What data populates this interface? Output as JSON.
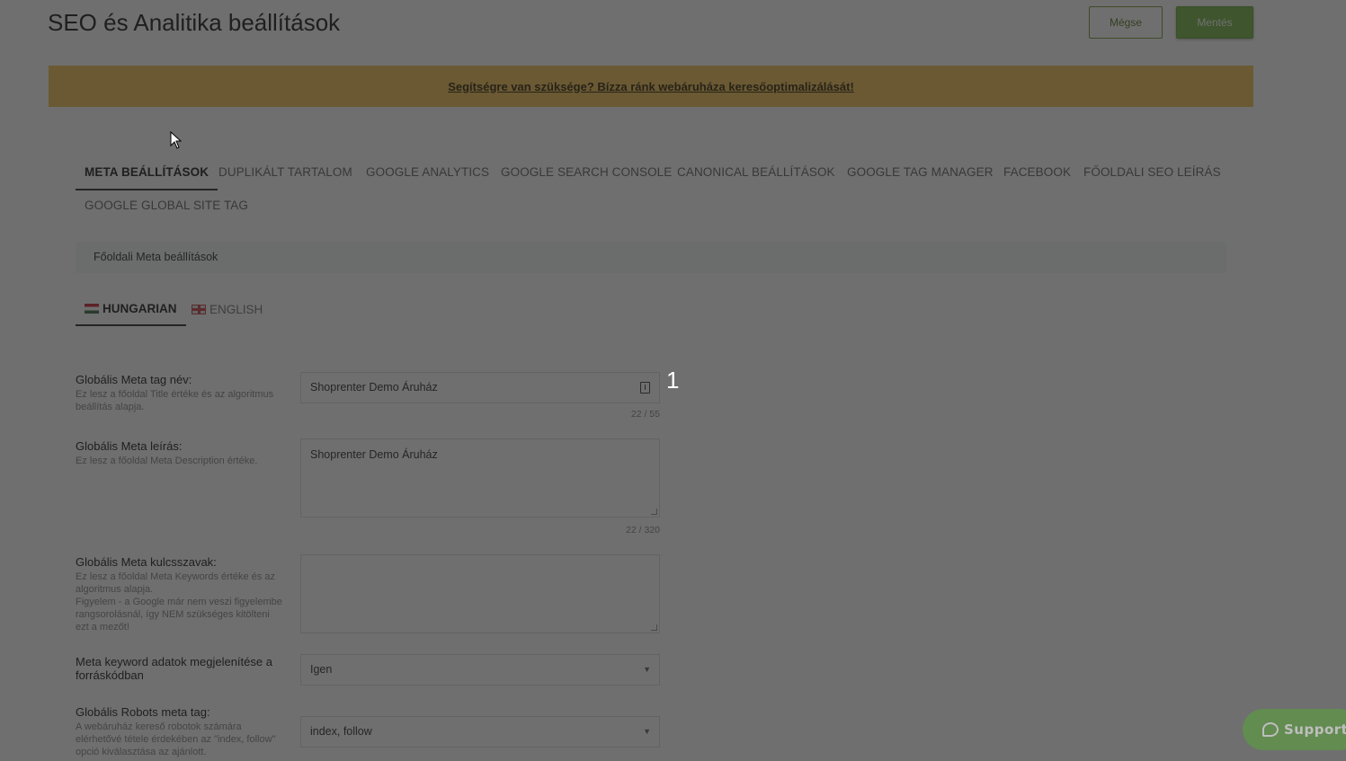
{
  "header": {
    "title": "SEO és Analitika beállítások",
    "cancel_label": "Mégse",
    "save_label": "Mentés"
  },
  "banner": {
    "link_text": "Segítségre van szüksége? Bízza ránk webáruháza keresőoptimalizálását!"
  },
  "tabs": [
    {
      "label": "META BEÁLLÍTÁSOK",
      "active": true
    },
    {
      "label": "DUPLIKÁLT TARTALOM",
      "active": false
    },
    {
      "label": "GOOGLE ANALYTICS",
      "active": false
    },
    {
      "label": "GOOGLE SEARCH CONSOLE",
      "active": false
    },
    {
      "label": "CANONICAL BEÁLLÍTÁSOK",
      "active": false
    },
    {
      "label": "GOOGLE TAG MANAGER",
      "active": false
    },
    {
      "label": "FACEBOOK",
      "active": false
    },
    {
      "label": "FŐOLDALI SEO LEÍRÁS",
      "active": false
    },
    {
      "label": "GOOGLE GLOBAL SITE TAG",
      "active": false
    }
  ],
  "section": {
    "title": "Főoldali Meta beállítások"
  },
  "languages": [
    {
      "label": "HUNGARIAN",
      "flag": "flag-hu",
      "active": true
    },
    {
      "label": "ENGLISH",
      "flag": "flag-en",
      "active": false
    }
  ],
  "fields": {
    "meta_title": {
      "label": "Globális Meta tag név:",
      "hint": "Ez lesz a főoldal Title értéke és az algoritmus beállítás alapja.",
      "value": "Shoprenter Demo Áruház",
      "counter": "22 / 55"
    },
    "meta_description": {
      "label": "Globális Meta leírás:",
      "hint": "Ez lesz a főoldal Meta Description értéke.",
      "value": "Shoprenter Demo Áruház",
      "counter": "22 / 320"
    },
    "meta_keywords": {
      "label": "Globális Meta kulcsszavak:",
      "hint": "Ez lesz a főoldal Meta Keywords értéke és az algoritmus alapja.",
      "hint2": "Figyelem - a Google már nem veszi figyelembe rangsorolásnál, így NEM szükséges kitölteni ezt a mezőt!",
      "value": ""
    },
    "keyword_display": {
      "label": "Meta keyword adatok megjelenítése a forráskódban",
      "value": "Igen"
    },
    "robots": {
      "label": "Globális Robots meta tag:",
      "hint": "A webáruház kereső robotok számára elérhetővé tétele érdekében az \"index, follow\" opció kiválasztása az ajánlott.",
      "value": "index, follow"
    }
  },
  "marker": "1",
  "support": {
    "label": "Support",
    "icon": "chat-bubble-icon"
  },
  "colors": {
    "primary_green": "#7ab648",
    "banner_yellow": "#f1c35a",
    "overlay": "rgba(30,30,30,0.64)"
  }
}
